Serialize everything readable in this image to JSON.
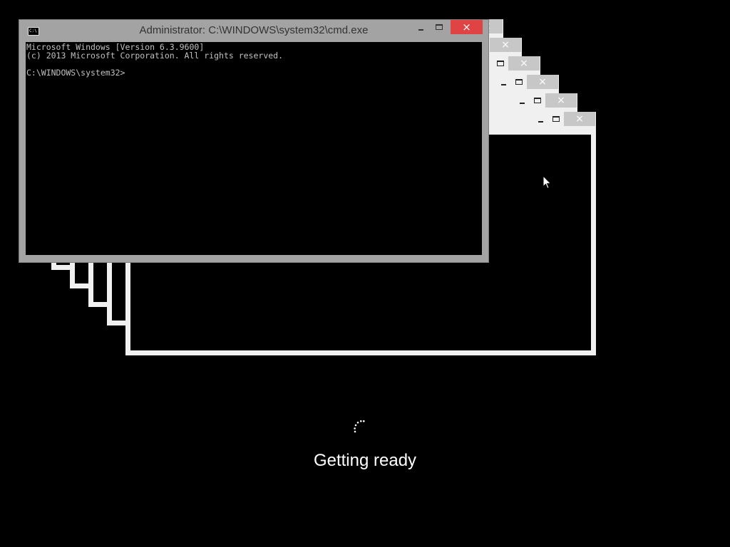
{
  "cmd_window": {
    "title": "Administrator: C:\\WINDOWS\\system32\\cmd.exe",
    "icon": "console-icon",
    "console_lines": [
      "Microsoft Windows [Version 6.3.9600]",
      "(c) 2013 Microsoft Corporation. All rights reserved.",
      "",
      "C:\\WINDOWS\\system32>"
    ],
    "close_color": "#e04343"
  },
  "background_windows": {
    "count": 6,
    "frame_color": "#f0f0f0",
    "close_button_color": "#c7c7c7",
    "close_glyph": "×"
  },
  "status": {
    "text": "Getting ready",
    "spinner": "loading-dots-icon"
  }
}
